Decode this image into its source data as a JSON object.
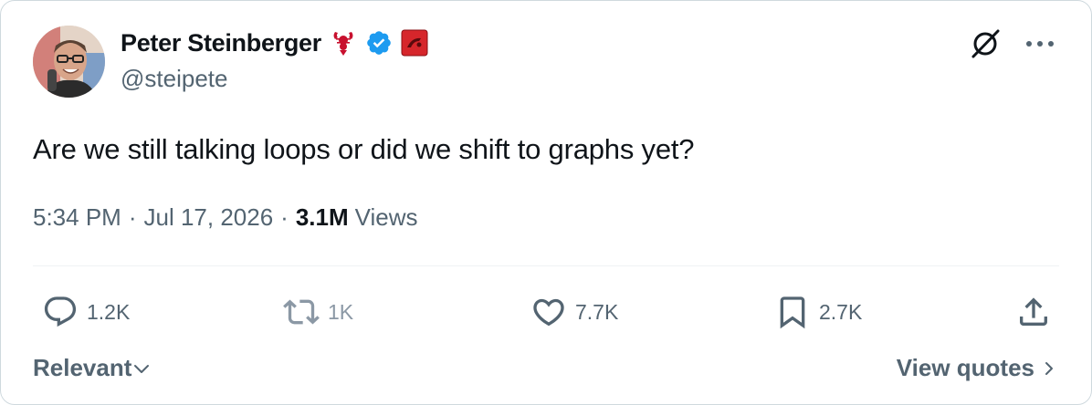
{
  "author": {
    "display_name": "Peter Steinberger",
    "handle": "@steipete",
    "badges": [
      "lobster-emoji",
      "verified-badge",
      "affiliate-badge"
    ]
  },
  "tweet": {
    "text": "Are we still talking loops or did we shift to graphs yet?",
    "time": "5:34 PM",
    "date": "Jul 17, 2026",
    "separator": "·",
    "views_count": "3.1M",
    "views_label": "Views"
  },
  "actions": {
    "reply_count": "1.2K",
    "repost_count": "1K",
    "like_count": "7.7K",
    "bookmark_count": "2.7K"
  },
  "footer": {
    "sort_label": "Relevant",
    "quotes_label": "View quotes"
  },
  "colors": {
    "text_primary": "#0f1419",
    "text_secondary": "#536471",
    "border": "#cfd9de",
    "verified_blue": "#1d9bf0",
    "badge_red": "#d6262b"
  }
}
